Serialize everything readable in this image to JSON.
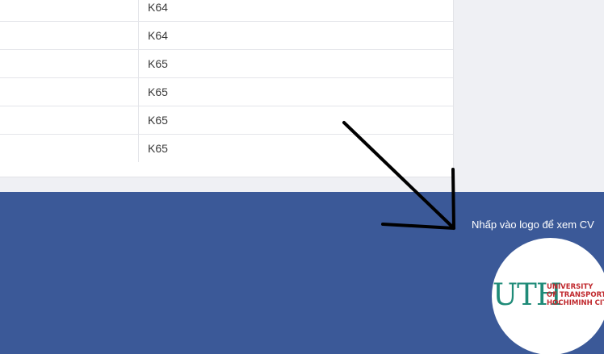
{
  "table": {
    "rows": [
      {
        "class": "K64"
      },
      {
        "class": "K64"
      },
      {
        "class": "K65"
      },
      {
        "class": "K65"
      },
      {
        "class": "K65"
      },
      {
        "class": "K65"
      }
    ]
  },
  "footer": {
    "hint": "Nhấp vào logo để xem CV",
    "logo": {
      "mark": "UTH",
      "line1": "UNIVERSITY",
      "line2": "OF TRANSPORT",
      "line3": "HOCHIMINH CITY"
    }
  },
  "colors": {
    "footer_bg": "#3b5998",
    "page_bg": "#eff0f4",
    "logo_green": "#1f8b78",
    "logo_red": "#c0282d"
  }
}
